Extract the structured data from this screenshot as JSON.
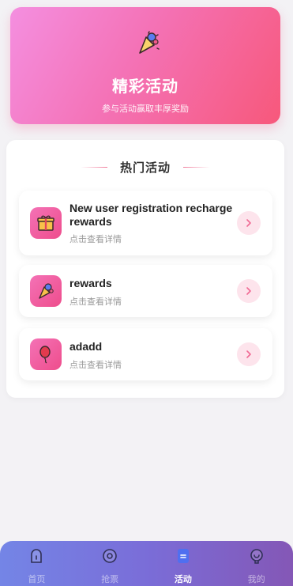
{
  "banner": {
    "icon": "party-popper-icon",
    "title": "精彩活动",
    "subtitle": "参与活动赢取丰厚奖励"
  },
  "section": {
    "title": "热门活动"
  },
  "activities": [
    {
      "icon": "gift-icon",
      "title": "New user registration recharge rewards",
      "desc": "点击查看详情"
    },
    {
      "icon": "party-popper-icon",
      "title": "rewards",
      "desc": "点击查看详情"
    },
    {
      "icon": "balloon-icon",
      "title": "adadd",
      "desc": "点击查看详情"
    }
  ],
  "tabbar": {
    "items": [
      {
        "label": "首页",
        "icon": "home-icon",
        "active": false
      },
      {
        "label": "抢票",
        "icon": "ticket-icon",
        "active": false
      },
      {
        "label": "活动",
        "icon": "activity-icon",
        "active": true
      },
      {
        "label": "我的",
        "icon": "profile-icon",
        "active": false
      }
    ]
  },
  "colors": {
    "accent": "#f472b6",
    "banner_end": "#f7587b",
    "tabbar_start": "#7485e6",
    "tabbar_end": "#8457b6"
  }
}
